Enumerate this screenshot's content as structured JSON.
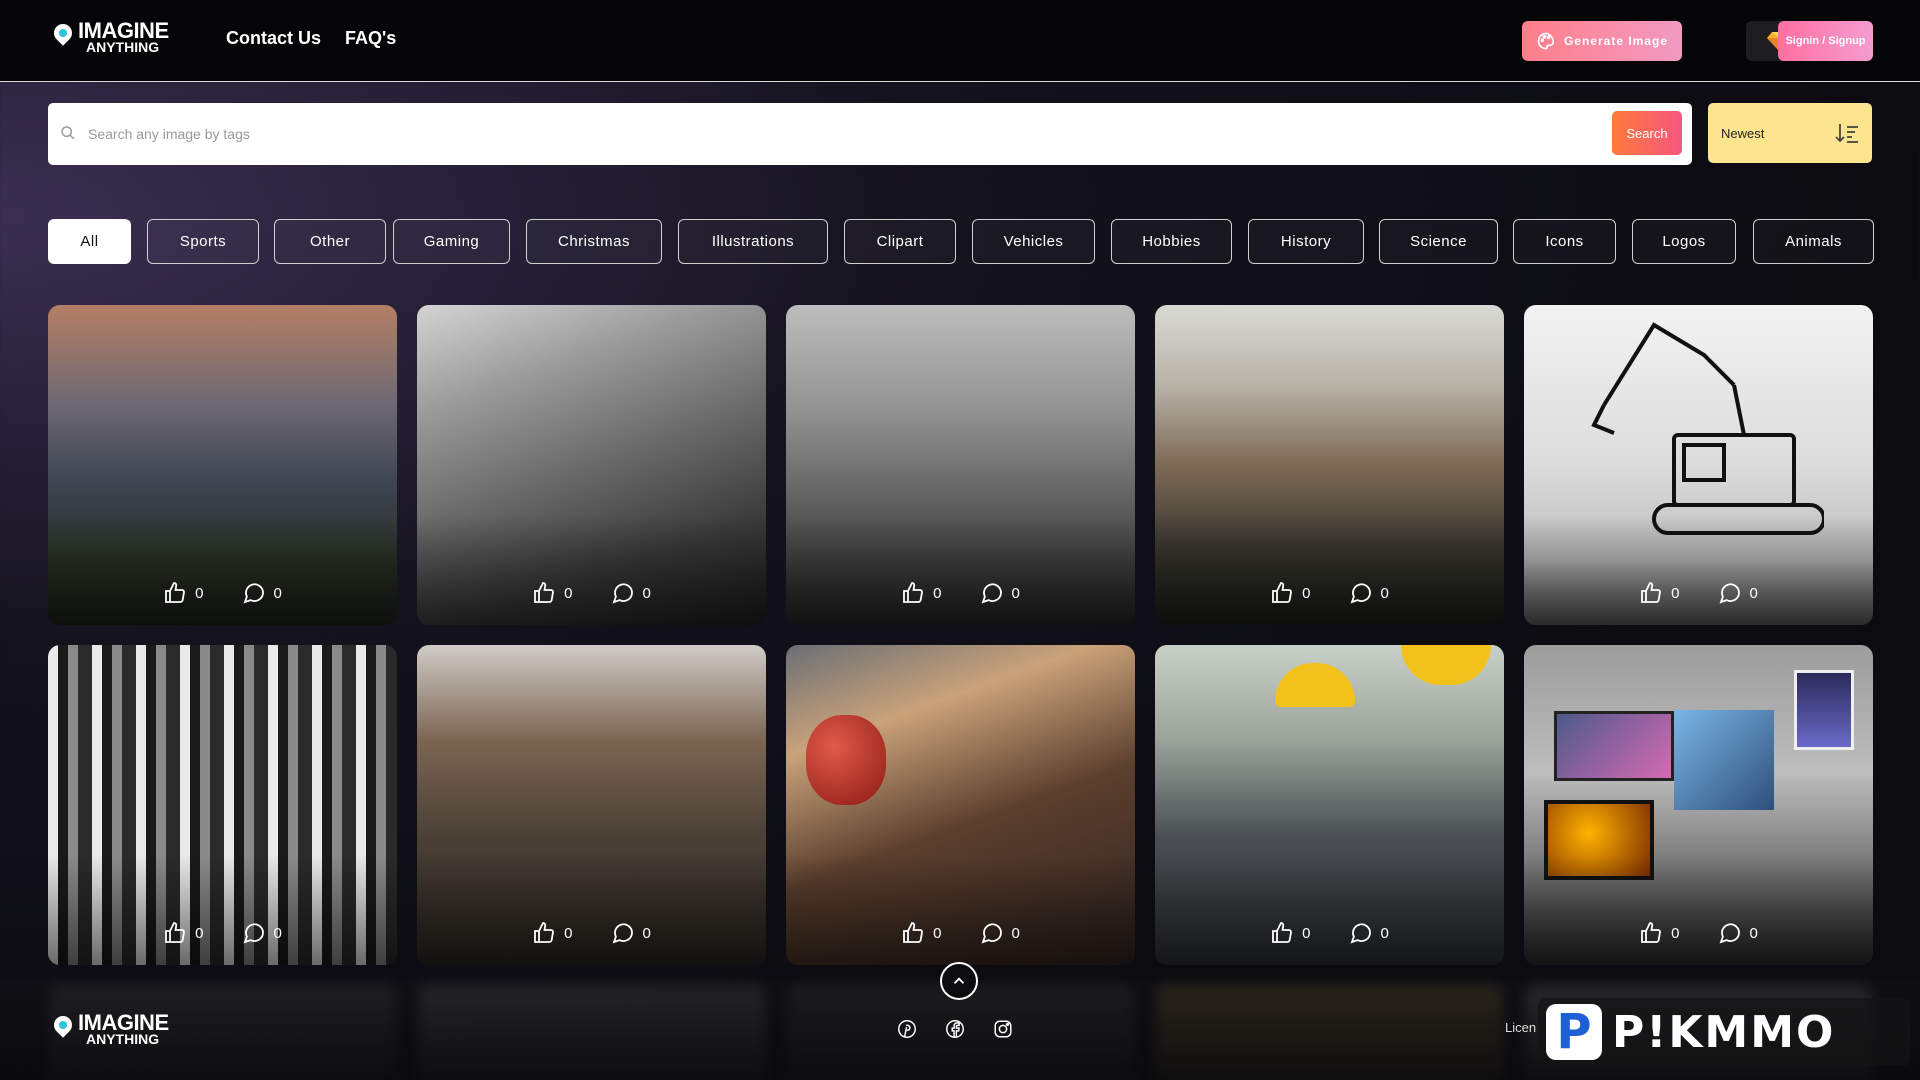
{
  "brand": {
    "line1": "IMAGINE",
    "line2": "ANYTHING"
  },
  "nav": {
    "contact": "Contact Us",
    "faq": "FAQ's"
  },
  "header": {
    "generate_label": "Generate Image",
    "signin_label": "Signin / Signup"
  },
  "search": {
    "placeholder": "Search any image by tags",
    "button_label": "Search"
  },
  "sort": {
    "selected": "Newest"
  },
  "tags": [
    "All",
    "Sports",
    "Other",
    "Gaming",
    "Christmas",
    "Illustrations",
    "Clipart",
    "Vehicles",
    "Hobbies",
    "History",
    "Science",
    "Icons",
    "Logos",
    "Animals"
  ],
  "cards": [
    {
      "likes": "0",
      "comments": "0"
    },
    {
      "likes": "0",
      "comments": "0"
    },
    {
      "likes": "0",
      "comments": "0"
    },
    {
      "likes": "0",
      "comments": "0"
    },
    {
      "likes": "0",
      "comments": "0"
    },
    {
      "likes": "0",
      "comments": "0"
    },
    {
      "likes": "0",
      "comments": "0"
    },
    {
      "likes": "0",
      "comments": "0"
    },
    {
      "likes": "0",
      "comments": "0"
    },
    {
      "likes": "0",
      "comments": "0"
    }
  ],
  "footer": {
    "links_text": "Licen",
    "social_icons": [
      "pinterest-icon",
      "facebook-icon",
      "instagram-icon"
    ]
  },
  "watermark": {
    "letter": "P",
    "text": "P!KMMO"
  },
  "colors": {
    "accent_orange": "#ff7a3c",
    "accent_pink": "#f5577e",
    "sort_yellow": "#fde58f"
  }
}
